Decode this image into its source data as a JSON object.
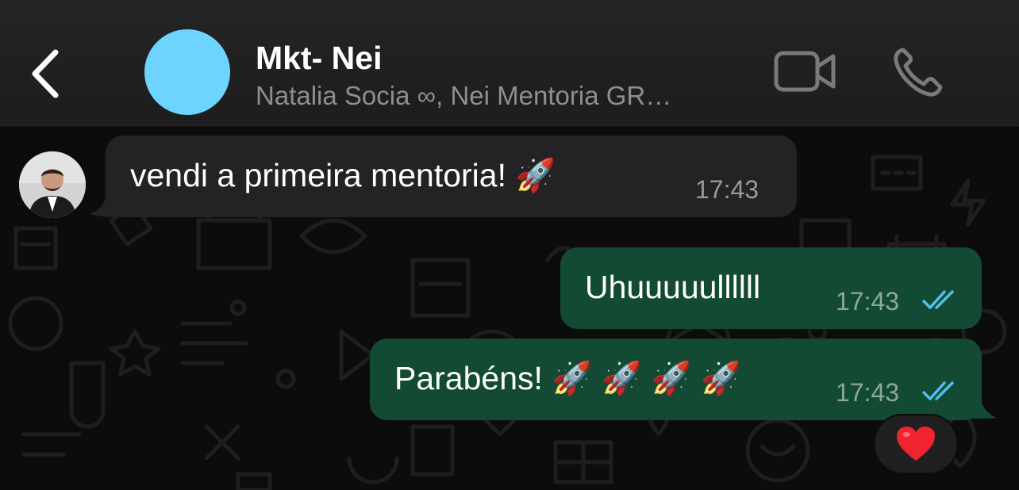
{
  "header": {
    "title": "Mkt- Nei",
    "subtitle": "Natalia Socia ∞, Nei Mentoria GR…",
    "back_icon": "chevron-left-icon",
    "video_icon": "video-camera-icon",
    "call_icon": "phone-icon"
  },
  "colors": {
    "header_bg": "#1f1f1f",
    "group_avatar": "#6dd3ff",
    "incoming_bubble": "#232325",
    "outgoing_bubble": "#134a34",
    "read_ticks": "#53bdeb"
  },
  "messages": [
    {
      "direction": "incoming",
      "text": "vendi a primeira mentoria! 🚀",
      "time": "17:43"
    },
    {
      "direction": "outgoing",
      "text": "Uhuuuuullllll",
      "time": "17:43",
      "status": "read"
    },
    {
      "direction": "outgoing",
      "text": "Parabéns! 🚀 🚀 🚀 🚀",
      "time": "17:43",
      "status": "read",
      "reaction": "❤️"
    }
  ]
}
